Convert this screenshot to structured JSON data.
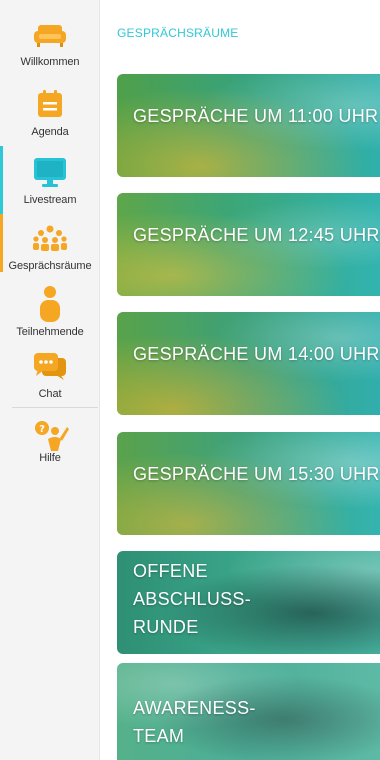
{
  "sidebar": {
    "items": [
      {
        "label": "Willkommen",
        "icon": "sofa-icon"
      },
      {
        "label": "Agenda",
        "icon": "calendar-icon"
      },
      {
        "label": "Livestream",
        "icon": "monitor-icon"
      },
      {
        "label": "Gesprächsräume",
        "icon": "group-icon"
      },
      {
        "label": "Teilnehmende",
        "icon": "person-icon"
      },
      {
        "label": "Chat",
        "icon": "chat-bubble-icon"
      },
      {
        "label": "Hilfe",
        "icon": "help-person-icon"
      }
    ]
  },
  "colors": {
    "accent": "#f5a623",
    "active_blue": "#2fc8d6",
    "icon_orange": "#f5a623",
    "icon_blue": "#26c3d6"
  },
  "main": {
    "section_title": "GESPRÄCHSRÄUME",
    "cards": [
      {
        "title": "GESPRÄCHE UM 11:00 UHR"
      },
      {
        "title": "GESPRÄCHE UM 12:45 UHR"
      },
      {
        "title": "GESPRÄCHE UM 14:00 UHR"
      },
      {
        "title": "GESPRÄCHE UM 15:30 UHR"
      },
      {
        "title": "OFFENE ABSCHLUSS-RUNDE"
      },
      {
        "title": "AWARENESS-TEAM"
      }
    ]
  }
}
